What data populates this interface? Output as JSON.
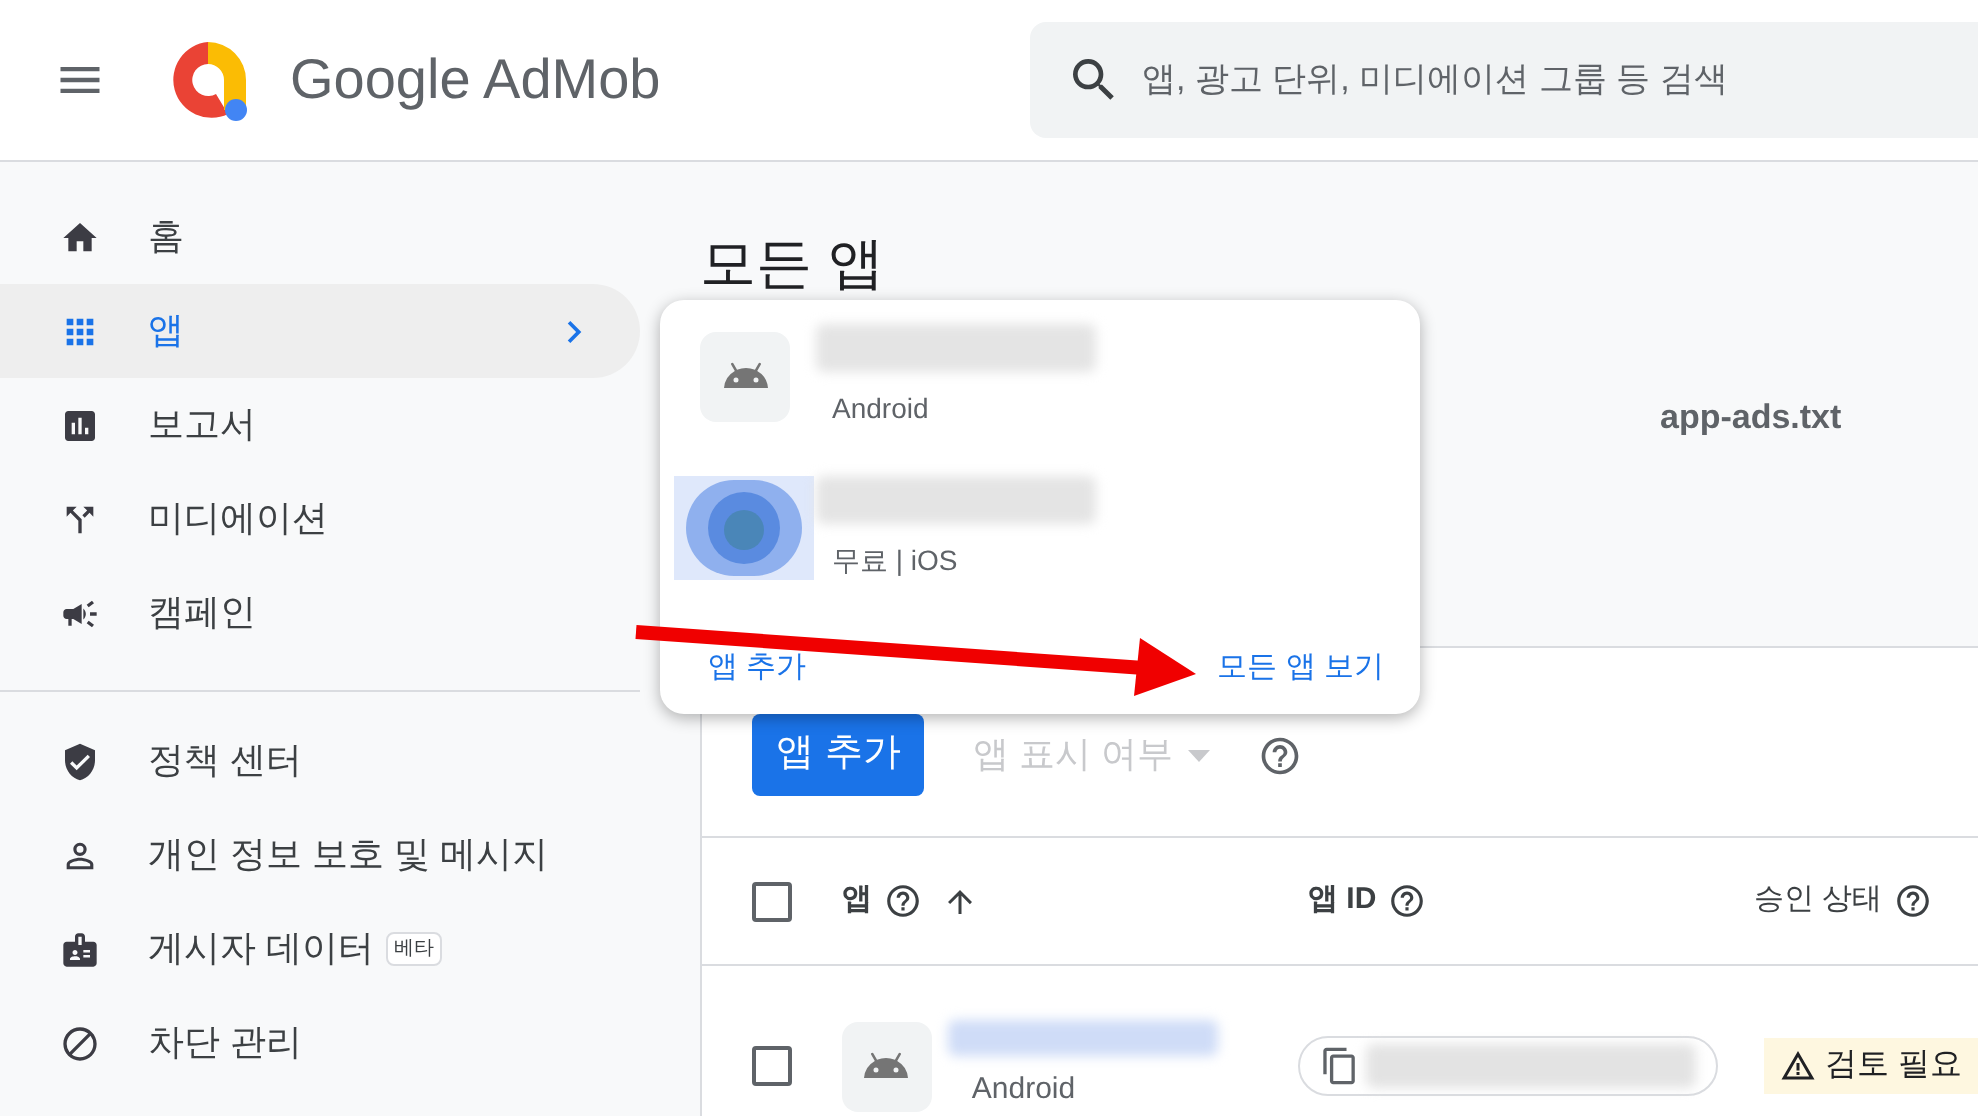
{
  "header": {
    "brand": "Google AdMob",
    "search": {
      "placeholder": "앱, 광고 단위, 미디에이션 그룹 등 검색"
    }
  },
  "sidebar": {
    "sections": [
      {
        "items": [
          {
            "label": "홈",
            "selected": false
          },
          {
            "label": "앱",
            "selected": true
          },
          {
            "label": "보고서",
            "selected": false
          },
          {
            "label": "미디에이션",
            "selected": false
          },
          {
            "label": "캠페인",
            "selected": false
          }
        ]
      },
      {
        "items": [
          {
            "label": "정책 센터",
            "selected": false
          },
          {
            "label": "개인 정보 보호 및 메시지",
            "selected": false
          },
          {
            "label": "게시자 데이터",
            "selected": false,
            "badge": "베타"
          },
          {
            "label": "차단 관리",
            "selected": false
          }
        ]
      }
    ]
  },
  "page": {
    "title": "모든 앱",
    "tab": "app-ads.txt"
  },
  "popup": {
    "apps": [
      {
        "kind": "android",
        "platform": "Android"
      },
      {
        "kind": "picture",
        "platform": "무료 | iOS"
      }
    ],
    "add_link": "앱 추가",
    "view_all_link": "모든 앱 보기"
  },
  "toolbar": {
    "add_button": "앱 추가",
    "visibility_dropdown": {
      "label": "앱 표시 여부",
      "disabled": true
    }
  },
  "table": {
    "all_selected": false,
    "columns": [
      {
        "label": "앱",
        "sorted": true
      },
      {
        "label": "앱 ID",
        "sorted": false
      },
      {
        "label": "승인 상태",
        "sorted": false
      }
    ],
    "rows": [
      {
        "selected": false,
        "platform": "Android",
        "status": "검토 필요"
      }
    ]
  }
}
